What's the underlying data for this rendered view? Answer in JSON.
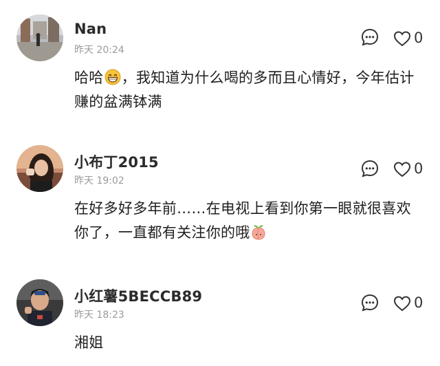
{
  "comments": [
    {
      "username": "Nan",
      "timestamp": "昨天 20:24",
      "likes": "0",
      "text_before_emoji": "哈哈",
      "emoji": "grinning-face-emoji",
      "text_after_emoji": "，我知道为什么喝的多而且心情好，今年估计赚的盆满钵满"
    },
    {
      "username": "小布丁2015",
      "timestamp": "昨天 19:02",
      "likes": "0",
      "text_before_emoji": "在好多好多年前……在电视上看到你第一眼就很喜欢你了，一直都有关注你的哦",
      "emoji": "peach-emoji",
      "text_after_emoji": ""
    },
    {
      "username": "小红薯5BECCB89",
      "timestamp": "昨天 18:23",
      "likes": "0",
      "text_before_emoji": "湘姐",
      "emoji": "",
      "text_after_emoji": ""
    }
  ],
  "icons": {
    "reply": "reply-bubble-icon",
    "like": "heart-outline-icon"
  },
  "colors": {
    "text": "#1f1f1f",
    "username": "#2b2b2b",
    "timestamp": "#9a9a9a",
    "icon": "#333333",
    "emoji_face": "#f7c33c",
    "emoji_peach": "#f6a99a"
  }
}
